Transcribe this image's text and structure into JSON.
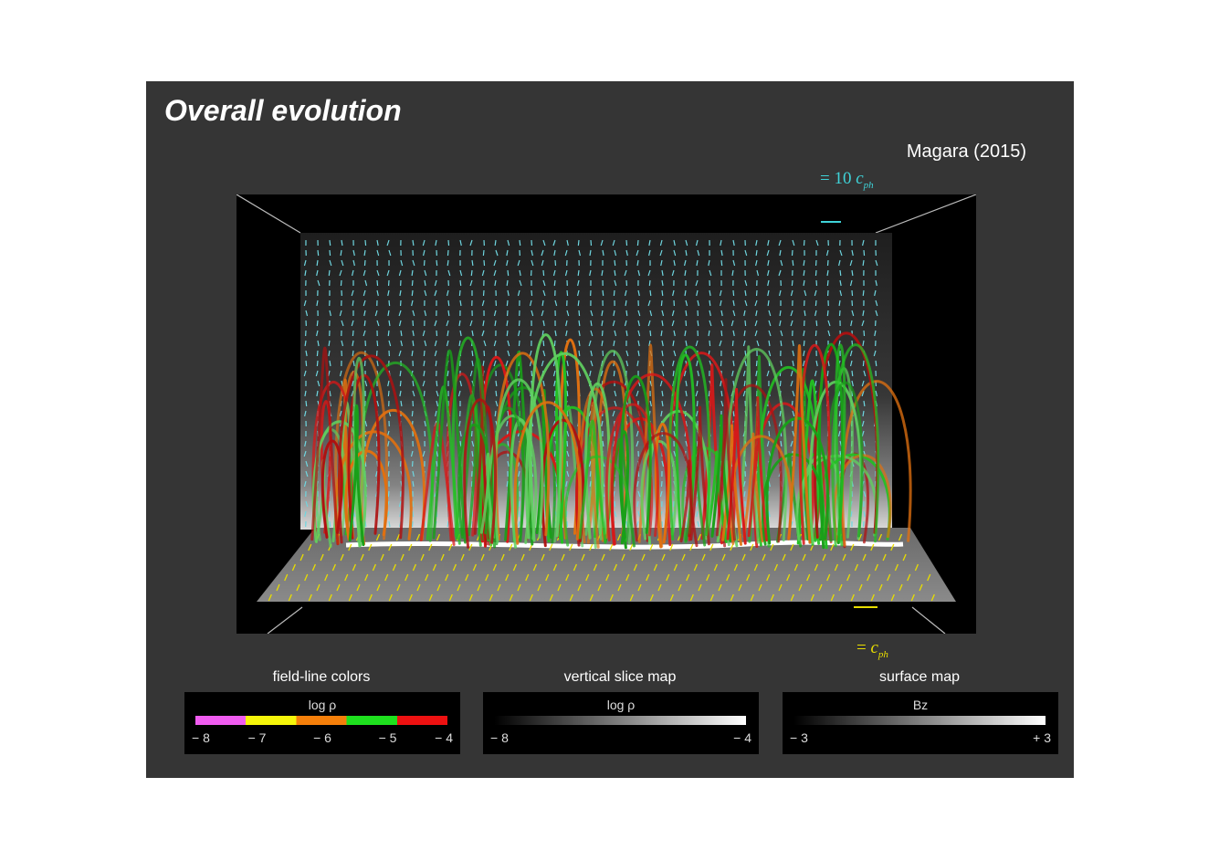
{
  "title": "Overall evolution",
  "citation": "Magara (2015)",
  "velocity_scales": {
    "top": {
      "prefix": "= 10",
      "symbol": "c",
      "subscript": "ph",
      "color": "#3fd3d8"
    },
    "bottom": {
      "prefix": "=",
      "symbol": "c",
      "subscript": "ph",
      "color": "#e8dd00"
    }
  },
  "colorbars": [
    {
      "title": "field-line colors",
      "variable": "log ρ",
      "ticks": [
        "− 8",
        "− 7",
        "− 6",
        "− 5",
        "− 4"
      ],
      "colors": [
        "#f05cf0",
        "#f5f50a",
        "#f57f0a",
        "#1ee01e",
        "#ee1111"
      ]
    },
    {
      "title": "vertical slice map",
      "variable": "log ρ",
      "ticks": [
        "− 8",
        "− 4"
      ],
      "colors": [
        "#000000",
        "#ffffff"
      ]
    },
    {
      "title": "surface map",
      "variable": "Bz",
      "ticks": [
        "− 3",
        "+ 3"
      ],
      "colors": [
        "#000000",
        "#ffffff"
      ]
    }
  ]
}
